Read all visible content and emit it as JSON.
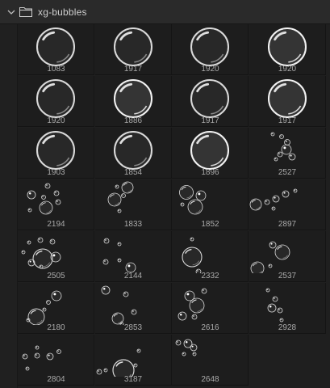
{
  "panel": {
    "group_name": "xg-bubbles",
    "icons": {
      "expand": "chevron-down-icon",
      "folder": "folder-icon"
    }
  },
  "brushes": [
    {
      "size": "1083",
      "style": "big"
    },
    {
      "size": "1917",
      "style": "big"
    },
    {
      "size": "1920",
      "style": "big"
    },
    {
      "size": "1920",
      "style": "bigbright"
    },
    {
      "size": "1920",
      "style": "big"
    },
    {
      "size": "1886",
      "style": "bigbright"
    },
    {
      "size": "1917",
      "style": "big"
    },
    {
      "size": "1917",
      "style": "bigbright"
    },
    {
      "size": "1903",
      "style": "big"
    },
    {
      "size": "1854",
      "style": "big"
    },
    {
      "size": "1896",
      "style": "bigbright"
    },
    {
      "size": "2527",
      "style": "scatterA"
    },
    {
      "size": "2194",
      "style": "scatterB"
    },
    {
      "size": "1833",
      "style": "scatterC"
    },
    {
      "size": "1852",
      "style": "scatterD"
    },
    {
      "size": "2897",
      "style": "scatterE"
    },
    {
      "size": "2505",
      "style": "scatterF"
    },
    {
      "size": "2144",
      "style": "scatterG"
    },
    {
      "size": "2332",
      "style": "scatterH"
    },
    {
      "size": "2537",
      "style": "scatterI"
    },
    {
      "size": "2180",
      "style": "scatterJ"
    },
    {
      "size": "2853",
      "style": "scatterK"
    },
    {
      "size": "2616",
      "style": "scatterL"
    },
    {
      "size": "2928",
      "style": "scatterM"
    },
    {
      "size": "2804",
      "style": "scatterN"
    },
    {
      "size": "3187",
      "style": "scatterO"
    },
    {
      "size": "2648",
      "style": "scatterP"
    }
  ]
}
